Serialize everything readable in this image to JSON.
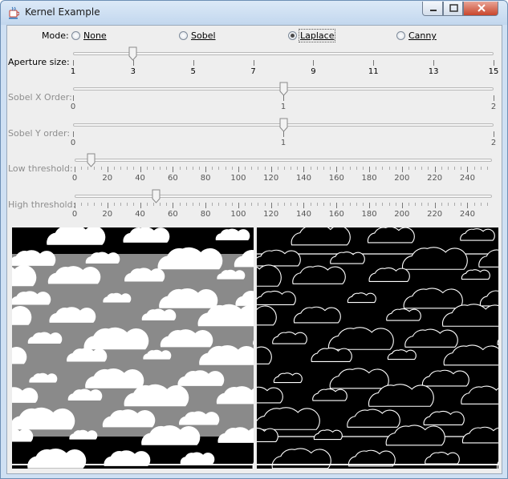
{
  "window": {
    "title": "Kernel Example"
  },
  "mode": {
    "label": "Mode:",
    "options": [
      "None",
      "Sobel",
      "Laplace",
      "Canny"
    ],
    "selected": "Laplace"
  },
  "sliders": [
    {
      "key": "aperture",
      "label": "Aperture size:",
      "enabled": true,
      "min": 1,
      "max": 15,
      "value": 3,
      "ticks": [
        "1",
        "3",
        "5",
        "7",
        "9",
        "11",
        "13",
        "15"
      ]
    },
    {
      "key": "sobel_x",
      "label": "Sobel X Order:",
      "enabled": false,
      "min": 0,
      "max": 2,
      "value": 1,
      "ticks": [
        "0",
        "1",
        "2"
      ]
    },
    {
      "key": "sobel_y",
      "label": "Sobel Y order:",
      "enabled": false,
      "min": 0,
      "max": 2,
      "value": 1,
      "ticks": [
        "0",
        "1",
        "2"
      ]
    },
    {
      "key": "low",
      "label": "Low threshold:",
      "enabled": false,
      "min": 0,
      "max": 255,
      "value": 10,
      "ticks": [
        "0",
        "20",
        "40",
        "60",
        "80",
        "100",
        "120",
        "140",
        "160",
        "180",
        "200",
        "220",
        "240"
      ]
    },
    {
      "key": "high",
      "label": "High threshold:",
      "enabled": false,
      "min": 0,
      "max": 255,
      "value": 50,
      "ticks": [
        "0",
        "20",
        "40",
        "60",
        "80",
        "100",
        "120",
        "140",
        "160",
        "180",
        "200",
        "220",
        "240"
      ]
    }
  ],
  "images": {
    "left": {
      "name": "original",
      "background": "#8a8a8a"
    },
    "right": {
      "name": "laplace-result",
      "background": "#000000"
    }
  }
}
